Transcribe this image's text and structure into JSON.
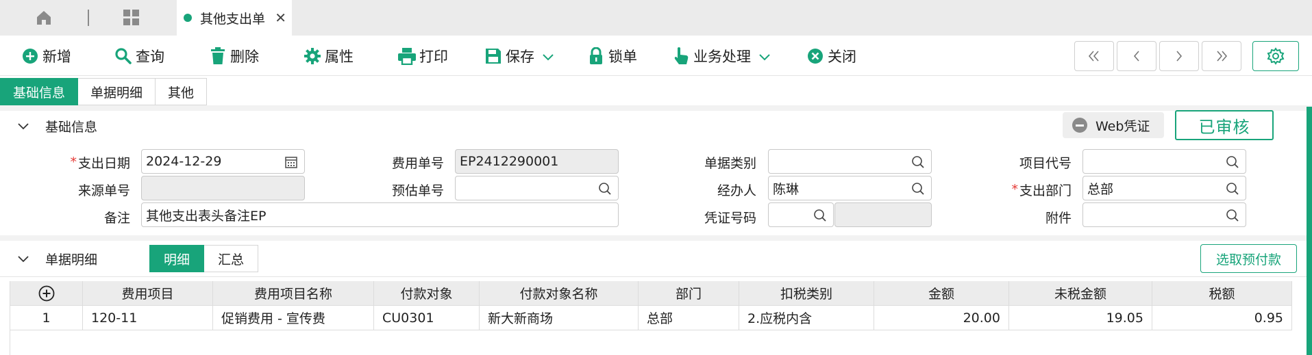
{
  "tabbar": {
    "home_icon": "home-icon",
    "grid_icon": "grid-icon",
    "doc_tab_label": "其他支出单",
    "close_glyph": "✕"
  },
  "toolbar": {
    "add": "新增",
    "query": "查询",
    "delete": "删除",
    "properties": "属性",
    "print": "打印",
    "save": "保存",
    "lock": "锁单",
    "business": "业务处理",
    "close": "关闭",
    "nav_first": "«",
    "nav_prev": "‹",
    "nav_next": "›",
    "nav_last": "»"
  },
  "section_tabs": [
    "基础信息",
    "单据明细",
    "其他"
  ],
  "basic_info": {
    "title": "基础信息",
    "web_voucher": "Web凭证",
    "status_badge": "已审核",
    "fields": {
      "expense_date_label": "支出日期",
      "expense_date_value": "2024-12-29",
      "fee_no_label": "费用单号",
      "fee_no_value": "EP2412290001",
      "doc_category_label": "单据类别",
      "doc_category_value": "",
      "project_code_label": "项目代号",
      "project_code_value": "",
      "source_no_label": "来源单号",
      "source_no_value": "",
      "estimate_no_label": "预估单号",
      "estimate_no_value": "",
      "handler_label": "经办人",
      "handler_value": "陈琳",
      "dept_label": "支出部门",
      "dept_value": "总部",
      "remark_label": "备注",
      "remark_value": "其他支出表头备注EP",
      "voucher_no_label": "凭证号码",
      "voucher_no_value": "",
      "attachment_label": "附件",
      "attachment_value": ""
    },
    "required_mark": "*"
  },
  "detail": {
    "title": "单据明细",
    "tabs": [
      "明细",
      "汇总"
    ],
    "prepay_button": "选取预付款",
    "columns": [
      "费用项目",
      "费用项目名称",
      "付款对象",
      "付款对象名称",
      "部门",
      "扣税类别",
      "金额",
      "未税金额",
      "税额"
    ],
    "rows": [
      {
        "idx": "1",
        "item": "120-11",
        "item_name": "促销费用 - 宣传费",
        "payee": "CU0301",
        "payee_name": "新大新商场",
        "dept": "总部",
        "tax_type": "2.应税内含",
        "amount": "20.00",
        "untaxed": "19.05",
        "tax": "0.95"
      }
    ]
  },
  "colors": {
    "accent": "#18a47a",
    "required": "#e53935"
  }
}
